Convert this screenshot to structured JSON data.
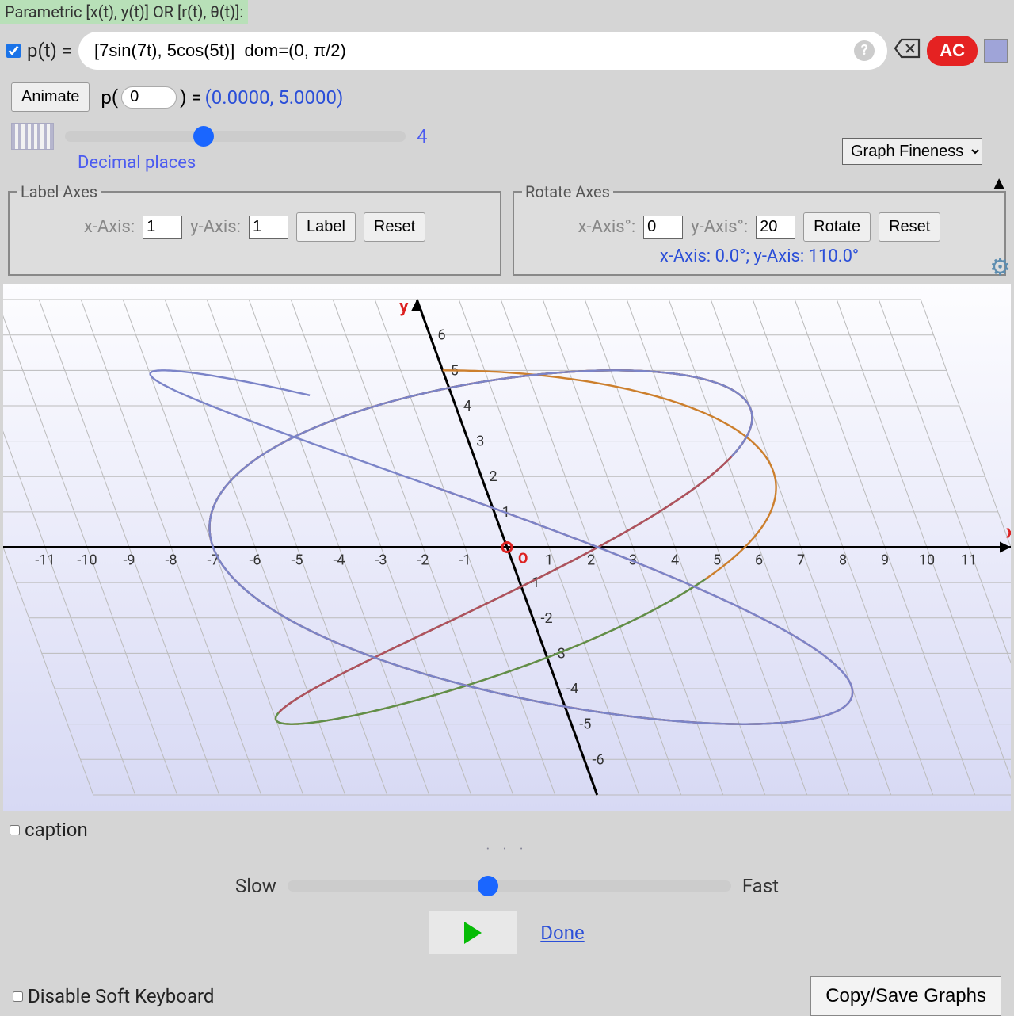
{
  "header": {
    "mode_label": "Parametric [x(t), y(t)] OR [r(t), θ(t)]:"
  },
  "formula": {
    "prefix": "p(t) = ",
    "value": "[7sin(7t), 5cos(5t)]  dom=(0, π/2)",
    "ac_label": "AC"
  },
  "animate": {
    "btn": "Animate",
    "eval_prefix": "p(",
    "eval_value": "0",
    "eval_suffix": ") =",
    "result": "(0.0000, 5.0000)"
  },
  "decimals": {
    "value": 4,
    "caption": "Decimal places"
  },
  "fineness": {
    "label": "Graph Fineness"
  },
  "label_axes": {
    "legend": "Label Axes",
    "x_label": "x-Axis:",
    "x_val": "1",
    "y_label": "y-Axis:",
    "y_val": "1",
    "label_btn": "Label",
    "reset_btn": "Reset"
  },
  "rotate_axes": {
    "legend": "Rotate Axes",
    "x_label": "x-Axis°:",
    "x_val": "0",
    "y_label": "y-Axis°:",
    "y_val": "20",
    "rotate_btn": "Rotate",
    "reset_btn": "Reset",
    "status": "x-Axis: 0.0°; y-Axis: 110.0°"
  },
  "graph": {
    "x_range": [
      -12,
      12
    ],
    "y_range": [
      -7,
      7
    ],
    "x_ticks": [
      -11,
      -10,
      -9,
      -8,
      -7,
      -6,
      -5,
      -4,
      -3,
      -2,
      -1,
      1,
      2,
      3,
      4,
      5,
      6,
      7,
      8,
      9,
      10,
      11
    ],
    "y_ticks": [
      -6,
      -5,
      -4,
      -3,
      -2,
      -1,
      1,
      2,
      3,
      4,
      5,
      6
    ],
    "y_axis_angle_deg": 110.0,
    "curves": [
      {
        "color": "#cc7f2d",
        "formula": "x=7sin(7t), y=5cos(5t)",
        "dom": [
          0,
          1.5708
        ]
      },
      {
        "color": "#5e8f4a",
        "formula": "x=7sin(7t), y=5cos(5t)",
        "dom": [
          0,
          1.5708
        ],
        "offset": 1
      },
      {
        "color": "#b05060",
        "formula": "x=7sin(7t), y=5cos(5t)",
        "dom": [
          0,
          1.5708
        ],
        "offset": 2
      },
      {
        "color": "#7b84c8",
        "formula": "x=7sin(7t), y=5cos(5t)",
        "dom": [
          0,
          1.5708
        ],
        "offset": 3
      }
    ],
    "origin_label": "O",
    "x_axis_label": "x",
    "y_axis_label": "y"
  },
  "footer": {
    "caption_label": "caption",
    "slow": "Slow",
    "fast": "Fast",
    "done": "Done",
    "disable_kb": "Disable Soft Keyboard",
    "copy_btn": "Copy/Save Graphs"
  },
  "chart_data": {
    "type": "line",
    "title": "",
    "xlabel": "x",
    "ylabel": "y",
    "xlim": [
      -12,
      12
    ],
    "ylim": [
      -7,
      7
    ],
    "parametric": {
      "x": "7*sin(7t)",
      "y": "5*cos(5t)",
      "t_domain": [
        0,
        1.5708
      ]
    },
    "axes_rotation": {
      "x_deg": 0.0,
      "y_deg": 110.0
    },
    "series_count": 4
  }
}
